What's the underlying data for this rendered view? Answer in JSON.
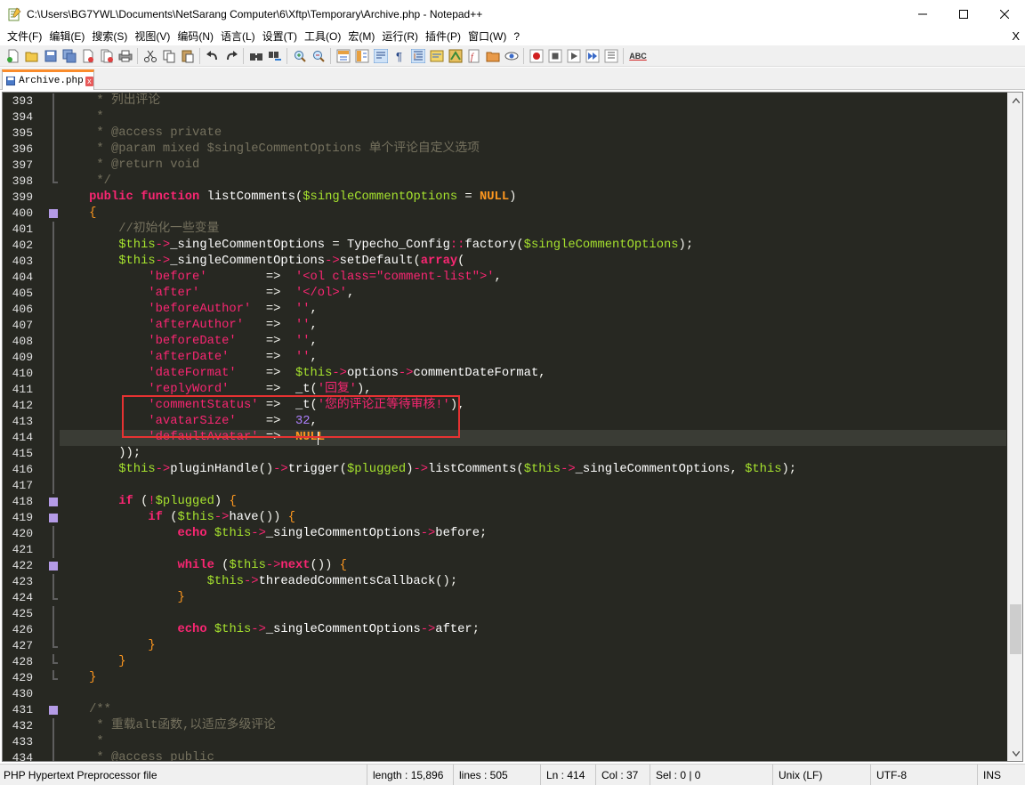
{
  "window": {
    "title": "C:\\Users\\BG7YWL\\Documents\\NetSarang Computer\\6\\Xftp\\Temporary\\Archive.php - Notepad++",
    "app_icon": "notepad-plus-plus-icon",
    "buttons": [
      "minimize-icon",
      "maximize-icon",
      "close-icon"
    ]
  },
  "menu": {
    "items": [
      "文件(F)",
      "编辑(E)",
      "搜索(S)",
      "视图(V)",
      "编码(N)",
      "语言(L)",
      "设置(T)",
      "工具(O)",
      "宏(M)",
      "运行(R)",
      "插件(P)",
      "窗口(W)",
      "?"
    ],
    "close_label": "X"
  },
  "toolbar": {
    "icons": [
      "new-file-icon",
      "open-file-icon",
      "save-icon",
      "save-all-icon",
      "close-icon",
      "close-all-icon",
      "print-icon",
      "cut-icon",
      "copy-icon",
      "paste-icon",
      "undo-icon",
      "redo-icon",
      "find-icon",
      "replace-icon",
      "zoom-in-icon",
      "zoom-out-icon",
      "sync-vertical-icon",
      "sync-horizontal-icon",
      "word-wrap-icon",
      "show-all-chars-icon",
      "indent-guide-icon",
      "udl-icon",
      "doc-map-icon",
      "function-list-icon",
      "folder-workspace-icon",
      "monitoring-icon",
      "record-macro-icon",
      "stop-macro-icon",
      "play-macro-icon",
      "run-macro-multiple-icon",
      "save-macro-icon",
      "spell-check-icon"
    ],
    "spell_label": "ABC"
  },
  "tab": {
    "label": "Archive.php",
    "close": "x"
  },
  "editor": {
    "lines": [
      {
        "n": "393",
        "fold": "line",
        "html": "<span class='c-cmt'>     * 列出评论</span>"
      },
      {
        "n": "394",
        "fold": "line",
        "html": "<span class='c-cmt'>     *</span>"
      },
      {
        "n": "395",
        "fold": "line",
        "html": "<span class='c-cmt'>     * @access private</span>"
      },
      {
        "n": "396",
        "fold": "line",
        "html": "<span class='c-cmt'>     * @param mixed $singleCommentOptions 单个评论自定义选项</span>"
      },
      {
        "n": "397",
        "fold": "line",
        "html": "<span class='c-cmt'>     * @return void</span>"
      },
      {
        "n": "398",
        "fold": "end",
        "html": "<span class='c-cmt'>     */</span>"
      },
      {
        "n": "399",
        "fold": "none",
        "html": "    <span class='c-kw'>public</span> <span class='c-kw'>function</span> <span class='c-fn'>listComments</span><span class='c-paren'>(</span><span class='c-var'>$singleCommentOptions</span> <span class='c-op'>=</span> <span class='c-const'>NULL</span><span class='c-paren'>)</span>"
      },
      {
        "n": "400",
        "fold": "box",
        "html": "    <span class='c-orange'>{</span>"
      },
      {
        "n": "401",
        "fold": "line",
        "html": "<span class='c-cmt'>        //初始化一些变量</span>"
      },
      {
        "n": "402",
        "fold": "line",
        "html": "        <span class='c-var'>$this</span><span class='c-pink'>-></span><span class='c-fn'>_singleCommentOptions</span> <span class='c-op'>=</span> <span class='c-fn'>Typecho_Config</span><span class='c-pink'>::</span><span class='c-fn'>factory</span><span class='c-paren'>(</span><span class='c-var'>$singleCommentOptions</span><span class='c-paren'>)</span><span class='c-op'>;</span>"
      },
      {
        "n": "403",
        "fold": "line",
        "html": "        <span class='c-var'>$this</span><span class='c-pink'>-></span><span class='c-fn'>_singleCommentOptions</span><span class='c-pink'>-></span><span class='c-fn'>setDefault</span><span class='c-paren'>(</span><span class='c-kw'>array</span><span class='c-paren'>(</span>"
      },
      {
        "n": "404",
        "fold": "line",
        "html": "            <span class='c-strred'>'before'</span>        <span class='c-op'>=></span>  <span class='c-strred'>'&lt;ol class=\"comment-list\"&gt;'</span><span class='c-op'>,</span>"
      },
      {
        "n": "405",
        "fold": "line",
        "html": "            <span class='c-strred'>'after'</span>         <span class='c-op'>=></span>  <span class='c-strred'>'&lt;/ol&gt;'</span><span class='c-op'>,</span>"
      },
      {
        "n": "406",
        "fold": "line",
        "html": "            <span class='c-strred'>'beforeAuthor'</span>  <span class='c-op'>=></span>  <span class='c-strred'>''</span><span class='c-op'>,</span>"
      },
      {
        "n": "407",
        "fold": "line",
        "html": "            <span class='c-strred'>'afterAuthor'</span>   <span class='c-op'>=></span>  <span class='c-strred'>''</span><span class='c-op'>,</span>"
      },
      {
        "n": "408",
        "fold": "line",
        "html": "            <span class='c-strred'>'beforeDate'</span>    <span class='c-op'>=></span>  <span class='c-strred'>''</span><span class='c-op'>,</span>"
      },
      {
        "n": "409",
        "fold": "line",
        "html": "            <span class='c-strred'>'afterDate'</span>     <span class='c-op'>=></span>  <span class='c-strred'>''</span><span class='c-op'>,</span>"
      },
      {
        "n": "410",
        "fold": "line",
        "html": "            <span class='c-strred'>'dateFormat'</span>    <span class='c-op'>=></span>  <span class='c-var'>$this</span><span class='c-pink'>-></span><span class='c-fn'>options</span><span class='c-pink'>-></span><span class='c-fn'>commentDateFormat</span><span class='c-op'>,</span>"
      },
      {
        "n": "411",
        "fold": "line",
        "html": "            <span class='c-strred'>'replyWord'</span>     <span class='c-op'>=></span>  <span class='c-fn'>_t</span><span class='c-paren'>(</span><span class='c-strred'>'回复'</span><span class='c-paren'>)</span><span class='c-op'>,</span>"
      },
      {
        "n": "412",
        "fold": "line",
        "html": "            <span class='c-strred'>'commentStatus'</span> <span class='c-op'>=></span>  <span class='c-fn'>_t</span><span class='c-paren'>(</span><span class='c-strred'>'您的评论正等待审核!'</span><span class='c-paren'>)</span><span class='c-op'>,</span>"
      },
      {
        "n": "413",
        "fold": "line",
        "html": "            <span class='c-strred'>'avatarSize'</span>    <span class='c-op'>=></span>  <span class='c-num'>32</span><span class='c-op'>,</span>"
      },
      {
        "n": "414",
        "fold": "line",
        "cur": true,
        "html": "            <span class='c-strred'>'defaultAvatar'</span> <span class='c-op'>=></span>  <span class='c-const'>NULL</span>"
      },
      {
        "n": "415",
        "fold": "line",
        "html": "        <span class='c-paren'>))</span><span class='c-op'>;</span>"
      },
      {
        "n": "416",
        "fold": "line",
        "html": "        <span class='c-var'>$this</span><span class='c-pink'>-></span><span class='c-fn'>pluginHandle</span><span class='c-paren'>()</span><span class='c-pink'>-></span><span class='c-fn'>trigger</span><span class='c-paren'>(</span><span class='c-var'>$plugged</span><span class='c-paren'>)</span><span class='c-pink'>-></span><span class='c-fn'>listComments</span><span class='c-paren'>(</span><span class='c-var'>$this</span><span class='c-pink'>-></span><span class='c-fn'>_singleCommentOptions</span><span class='c-op'>,</span> <span class='c-var'>$this</span><span class='c-paren'>)</span><span class='c-op'>;</span>"
      },
      {
        "n": "417",
        "fold": "line",
        "html": ""
      },
      {
        "n": "418",
        "fold": "box",
        "html": "        <span class='c-kw'>if</span> <span class='c-paren'>(</span><span class='c-pink'>!</span><span class='c-var'>$plugged</span><span class='c-paren'>)</span> <span class='c-orange'>{</span>"
      },
      {
        "n": "419",
        "fold": "box",
        "html": "            <span class='c-kw'>if</span> <span class='c-paren'>(</span><span class='c-var'>$this</span><span class='c-pink'>-></span><span class='c-fn'>have</span><span class='c-paren'>())</span> <span class='c-orange'>{</span>"
      },
      {
        "n": "420",
        "fold": "line",
        "html": "                <span class='c-kw'>echo</span> <span class='c-var'>$this</span><span class='c-pink'>-></span><span class='c-fn'>_singleCommentOptions</span><span class='c-pink'>-></span><span class='c-fn'>before</span><span class='c-op'>;</span>"
      },
      {
        "n": "421",
        "fold": "line",
        "html": ""
      },
      {
        "n": "422",
        "fold": "box",
        "html": "                <span class='c-kw'>while</span> <span class='c-paren'>(</span><span class='c-var'>$this</span><span class='c-pink'>-></span><span class='c-kw'>next</span><span class='c-paren'>())</span> <span class='c-orange'>{</span>"
      },
      {
        "n": "423",
        "fold": "line",
        "html": "                    <span class='c-var'>$this</span><span class='c-pink'>-></span><span class='c-fn'>threadedCommentsCallback</span><span class='c-paren'>()</span><span class='c-op'>;</span>"
      },
      {
        "n": "424",
        "fold": "end",
        "html": "                <span class='c-orange'>}</span>"
      },
      {
        "n": "425",
        "fold": "line",
        "html": ""
      },
      {
        "n": "426",
        "fold": "line",
        "html": "                <span class='c-kw'>echo</span> <span class='c-var'>$this</span><span class='c-pink'>-></span><span class='c-fn'>_singleCommentOptions</span><span class='c-pink'>-></span><span class='c-fn'>after</span><span class='c-op'>;</span>"
      },
      {
        "n": "427",
        "fold": "end",
        "html": "            <span class='c-orange'>}</span>"
      },
      {
        "n": "428",
        "fold": "end",
        "html": "        <span class='c-orange'>}</span>"
      },
      {
        "n": "429",
        "fold": "end",
        "html": "    <span class='c-orange'>}</span>"
      },
      {
        "n": "430",
        "fold": "none",
        "html": ""
      },
      {
        "n": "431",
        "fold": "box",
        "html": "<span class='c-cmt'>    /**</span>"
      },
      {
        "n": "432",
        "fold": "line",
        "html": "<span class='c-cmt'>     * 重载alt函数,以适应多级评论</span>"
      },
      {
        "n": "433",
        "fold": "line",
        "html": "<span class='c-cmt'>     *</span>"
      },
      {
        "n": "434",
        "fold": "line",
        "html": "<span class='c-cmt'>     * @access public</span>"
      }
    ]
  },
  "status": {
    "file_type": "PHP Hypertext Preprocessor file",
    "length": "length : 15,896",
    "lines": "lines : 505",
    "ln": "Ln : 414",
    "col": "Col : 37",
    "sel": "Sel : 0 | 0",
    "eol": "Unix (LF)",
    "encoding": "UTF-8",
    "mode": "INS"
  }
}
